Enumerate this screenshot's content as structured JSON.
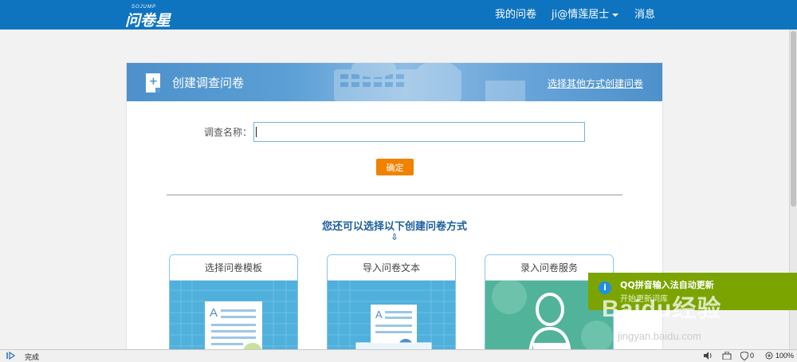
{
  "topbar": {
    "logo_sub": "SOJUMP",
    "logo": "问卷星",
    "nav_my_surveys": "我的问卷",
    "nav_user": "ji@情莲居士",
    "nav_messages": "消息",
    "color": "#0f74c0"
  },
  "panel": {
    "header_title": "创建调查问卷",
    "header_link": "选择其他方式创建问卷",
    "name_label": "调查名称：",
    "name_value": "",
    "confirm_label": "确定",
    "alt_title": "您还可以选择以下创建问卷方式",
    "alt_arrow": "⇩",
    "cards": [
      {
        "label": "选择问卷模板"
      },
      {
        "label": "导入问卷文本"
      },
      {
        "label": "录入问卷服务"
      }
    ],
    "accent": "#f08200"
  },
  "popup": {
    "icon": "i",
    "title": "QQ拼音输入法自动更新",
    "subtitle": "开始更新词库",
    "color": "#7ba400"
  },
  "watermark": {
    "logo": "Baidu经验",
    "url": "jingyan.baidu.com"
  },
  "statusbar": {
    "status": "完成",
    "shield_count": "0",
    "zoom": "100%"
  }
}
